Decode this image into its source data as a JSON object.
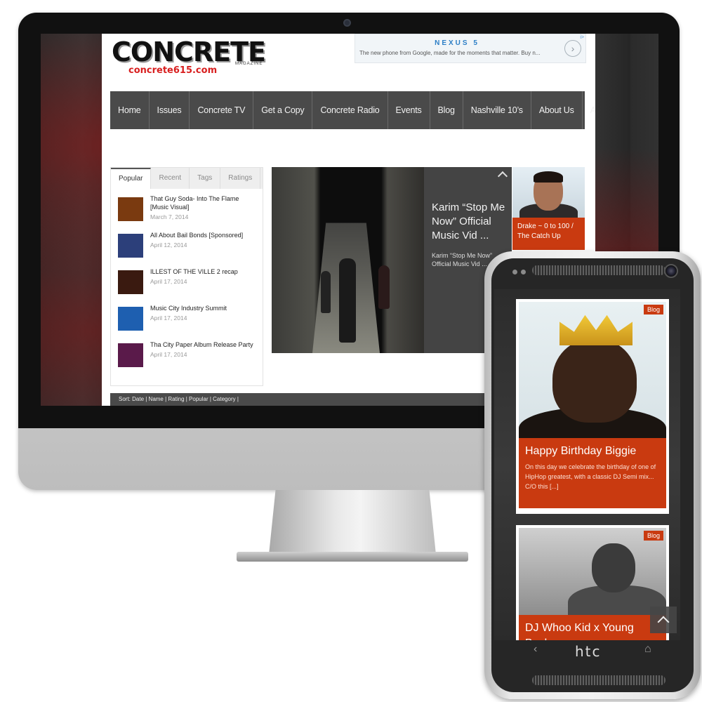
{
  "site": {
    "logo": {
      "main": "CONCRETE",
      "tagline": "MAGAZINE",
      "url": "concrete615.com"
    },
    "ad": {
      "title": "NEXUS 5",
      "text": "The new phone from Google, made for the moments that matter. Buy n...",
      "next_icon": "chevron-right-icon",
      "close_label": "i>"
    },
    "nav": [
      "Home",
      "Issues",
      "Concrete TV",
      "Get a Copy",
      "Concrete Radio",
      "Events",
      "Blog",
      "Nashville 10’s",
      "About Us",
      "Advertise"
    ],
    "tabs": [
      "Popular",
      "Recent",
      "Tags",
      "Ratings"
    ],
    "popular": [
      {
        "title": "That Guy Soda- Into The Flame [Music Visual]",
        "date": "March 7, 2014",
        "thumb_color": "#7a3a10"
      },
      {
        "title": "All About Bail Bonds [Sponsored]",
        "date": "April 12, 2014",
        "thumb_color": "#2c3f7a"
      },
      {
        "title": "ILLEST OF THE VILLE 2 recap",
        "date": "April 17, 2014",
        "thumb_color": "#3a1a10"
      },
      {
        "title": "Music City Industry Summit",
        "date": "April 17, 2014",
        "thumb_color": "#1e5fb0"
      },
      {
        "title": "Tha City Paper Album Release Party",
        "date": "April 17, 2014",
        "thumb_color": "#5a1a4a"
      }
    ],
    "feature": {
      "title": "Karim “Stop Me Now” Official Music Vid ...",
      "desc": "Karim “Stop Me Now” Official Music Vid ..."
    },
    "side_post": {
      "caption": "Drake ~ 0 to 100 / The Catch Up"
    },
    "sort_bar": "Sort: Date | Name | Rating | Popular | Category |"
  },
  "phone": {
    "brand": "htc",
    "cards": [
      {
        "tag": "Blog",
        "title": "Happy Birthday Biggie",
        "desc": "On this day we celebrate the birthday of one of HipHop greatest, with a classic DJ Semi mix... C/O this [...]"
      },
      {
        "tag": "Blog",
        "title": "DJ Whoo Kid x Young Buck",
        "desc": ""
      }
    ],
    "nav_back": "‹",
    "nav_home": "⌂",
    "totop_icon": "chevron-up-icon"
  },
  "colors": {
    "accent": "#c93a10",
    "nav_bg": "#4a4a4a",
    "logo_red": "#d81f1f",
    "ad_blue": "#2d7fc6"
  }
}
